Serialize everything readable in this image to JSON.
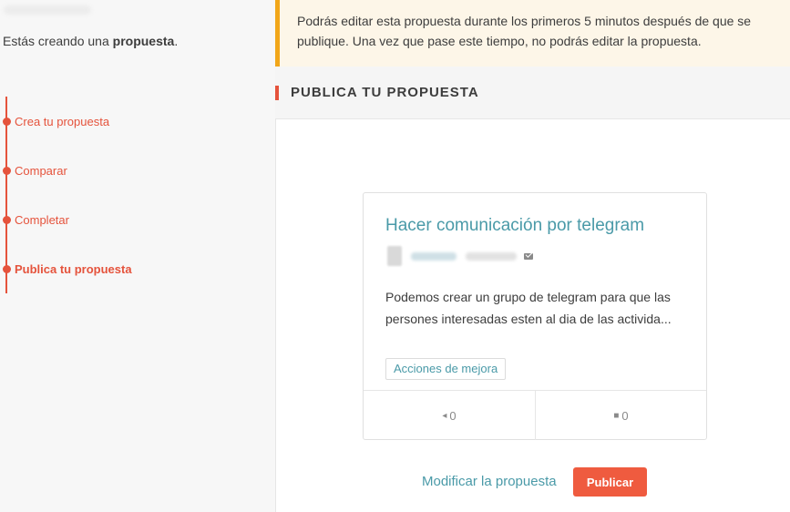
{
  "sidebar": {
    "creating_prefix": "Estás creando una ",
    "creating_bold": "propuesta",
    "creating_suffix": ".",
    "steps": [
      {
        "label": "Crea tu propuesta"
      },
      {
        "label": "Comparar"
      },
      {
        "label": "Completar"
      },
      {
        "label": "Publica tu propuesta"
      }
    ]
  },
  "notice": {
    "text": "Podrás editar esta propuesta durante los primeros 5 minutos después de que se publique. Una vez que pase este tiempo, no podrás editar la propuesta."
  },
  "section": {
    "title": "PUBLICA TU PROPUESTA"
  },
  "card": {
    "title": "Hacer comunicación por telegram",
    "body": "Podemos crear un grupo de telegram para que las persones interesadas esten al dia de las activida...",
    "tag": "Acciones de mejora",
    "supports_count": "0",
    "comments_count": "0"
  },
  "actions": {
    "modify_label": "Modificar la propuesta",
    "publish_label": "Publicar"
  },
  "colors": {
    "accent": "#e5533c",
    "link": "#4a9aa8",
    "warning_border": "#f1a619",
    "warning_bg": "#fdf6e8"
  },
  "icons": {
    "author_contact": "envelope-icon",
    "supports": "megaphone-icon",
    "comments": "comment-icon"
  }
}
